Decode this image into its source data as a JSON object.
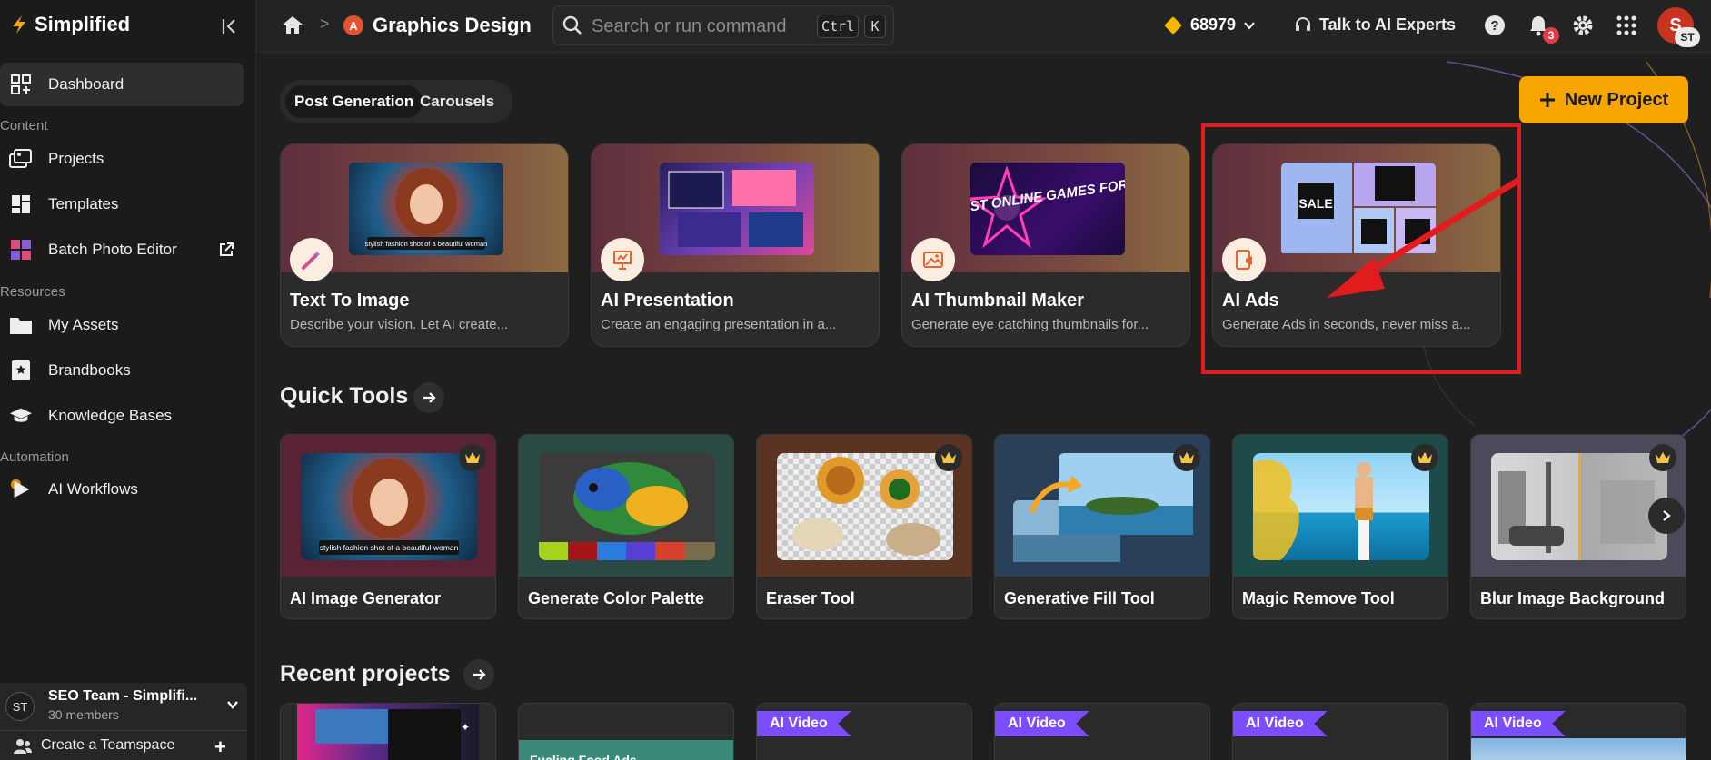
{
  "sidebar": {
    "brand": "Simplified",
    "items": [
      {
        "label": "Dashboard"
      },
      {
        "label": "Projects"
      },
      {
        "label": "Templates"
      },
      {
        "label": "Batch Photo Editor"
      },
      {
        "label": "My Assets"
      },
      {
        "label": "Brandbooks"
      },
      {
        "label": "Knowledge Bases"
      },
      {
        "label": "AI Workflows"
      }
    ],
    "sections": {
      "content": "Content",
      "resources": "Resources",
      "automation": "Automation"
    },
    "team": {
      "avatar": "ST",
      "name": "SEO Team - Simplifi...",
      "members": "30 members"
    },
    "create_team": "Create a Teamspace"
  },
  "topbar": {
    "breadcrumb_sep": ">",
    "title": "Graphics Design",
    "app_icon_letter": "A",
    "search_placeholder": "Search or run command",
    "kbd_ctrl": "Ctrl",
    "kbd_k": "K",
    "credits": "68979",
    "talk": "Talk to AI Experts",
    "notifications": "3",
    "user_initial": "S",
    "user_badge": "ST"
  },
  "main": {
    "tabs": [
      {
        "label": "Post Generation"
      },
      {
        "label": "Carousels"
      }
    ],
    "new_project": "New Project",
    "features": [
      {
        "title": "Text To Image",
        "desc": "Describe your vision. Let AI create...",
        "thumb_caption": "stylish fashion shot of a beautiful woman"
      },
      {
        "title": "AI Presentation",
        "desc": "Create an engaging presentation in a..."
      },
      {
        "title": "AI Thumbnail Maker",
        "desc": "Generate eye catching thumbnails for...",
        "thumb_text": "BEST ONLINE GAMES FOR BEGINNERS"
      },
      {
        "title": "AI Ads",
        "desc": "Generate Ads in seconds, never miss a...",
        "thumb_text": "SALE"
      }
    ],
    "quick_tools_title": "Quick Tools",
    "tools": [
      {
        "name": "AI Image Generator",
        "thumb_caption": "stylish fashion shot of a beautiful woman"
      },
      {
        "name": "Generate Color Palette"
      },
      {
        "name": "Eraser Tool"
      },
      {
        "name": "Generative Fill Tool"
      },
      {
        "name": "Magic Remove Tool"
      },
      {
        "name": "Blur Image Background"
      }
    ],
    "recent_title": "Recent projects",
    "recent": [
      {
        "tag": ""
      },
      {
        "tag": "",
        "caption": "Fueling Food Ads"
      },
      {
        "tag": "AI Video"
      },
      {
        "tag": "AI Video"
      },
      {
        "tag": "AI Video"
      },
      {
        "tag": "AI Video"
      }
    ]
  },
  "colors": {
    "accent": "#f7a600",
    "highlight": "#e21c1c",
    "video_tag": "#7c4dff"
  }
}
